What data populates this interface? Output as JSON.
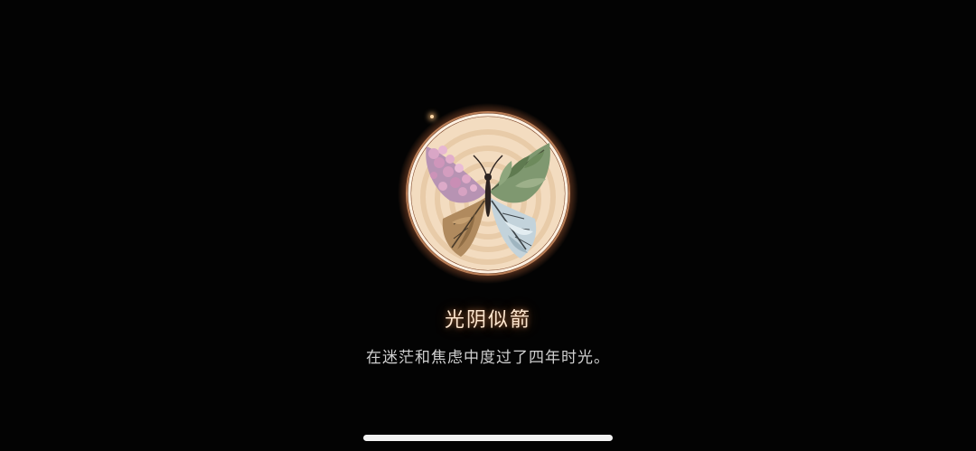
{
  "achievement": {
    "title": "光阴似箭",
    "description": "在迷茫和焦虑中度过了四年时光。",
    "emblem_icon": "butterfly-seasons-emblem-icon"
  },
  "colors": {
    "background": "#030303",
    "glow": "#ffb07a",
    "title_text": "#fde6cf",
    "description_text": "#cfcfcf"
  }
}
